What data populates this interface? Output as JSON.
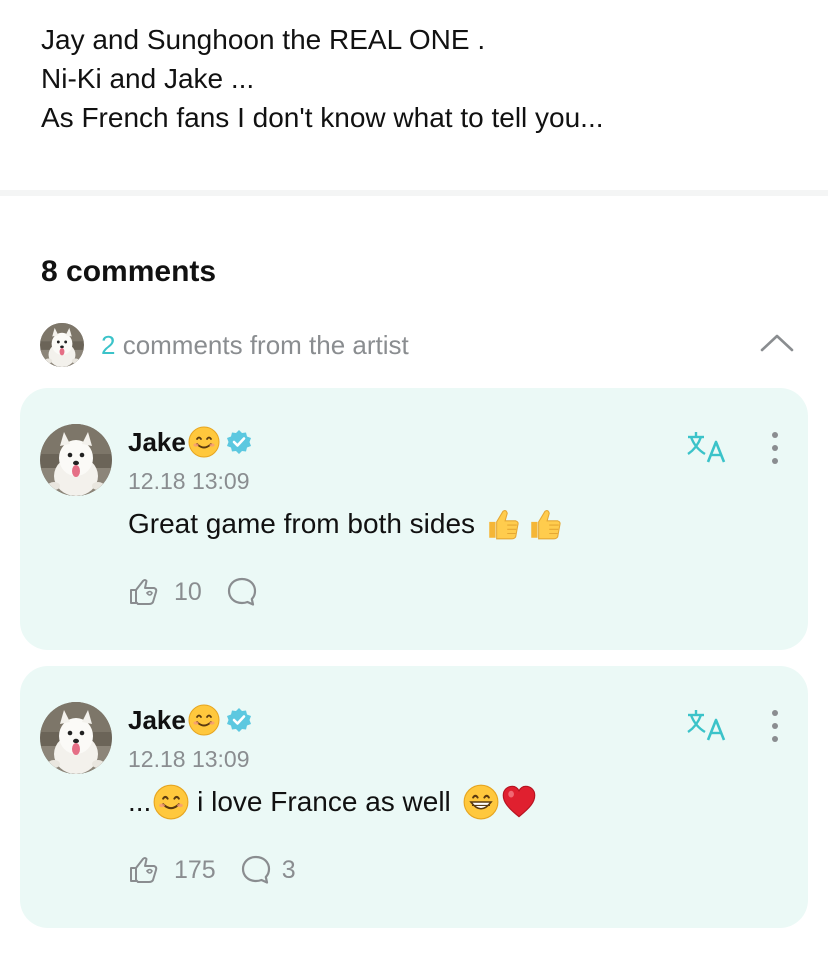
{
  "post": {
    "lines": [
      "Jay and Sunghoon the REAL ONE .",
      "Ni-Ki and Jake ...",
      "As French fans I don't know what to tell you..."
    ]
  },
  "comments_header": {
    "title": "8 comments",
    "artist_count": "2",
    "artist_label": " comments from the artist",
    "collapse_icon": "chevron-up-icon"
  },
  "comments": [
    {
      "author": "Jake",
      "time": "12.18 13:09",
      "text": "Great game from both sides",
      "text_emojis": [
        "thumbs-up",
        "thumbs-up"
      ],
      "likes": "10",
      "replies": ""
    },
    {
      "author": "Jake",
      "time": "12.18 13:09",
      "text_prefix": "...",
      "text": " i love France as well ",
      "text_emojis": [
        "smiling-face",
        "grinning-face",
        "red-heart"
      ],
      "likes": "175",
      "replies": "3"
    }
  ],
  "colors": {
    "accent": "#3bc3c9",
    "card_bg": "#ebf9f6",
    "muted": "#8a8d90",
    "verified": "#5cc8e0"
  }
}
